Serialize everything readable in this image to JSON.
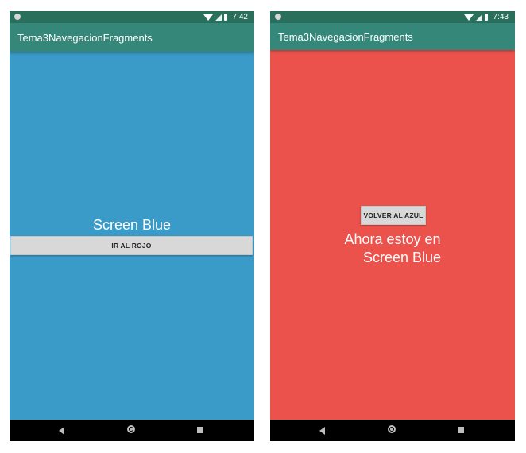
{
  "colors": {
    "left_status": "#2a6f5c",
    "left_appbar": "#348779",
    "left_content": "#3a9ac8",
    "right_status": "#2a6f5c",
    "right_appbar": "#348779",
    "right_content": "#ec524c"
  },
  "left": {
    "status_time": "7:42",
    "app_title": "Tema3NavegacionFragments",
    "screen_title": "Screen Blue",
    "button_label": "IR AL ROJO"
  },
  "right": {
    "status_time": "7:43",
    "app_title": "Tema3NavegacionFragments",
    "button_label": "VOLVER AL AZUL",
    "message_line1": "Ahora estoy en",
    "message_line2": "Screen Blue"
  },
  "icons": {
    "status": [
      "notification-dot-icon",
      "wifi-icon",
      "signal-icon",
      "battery-icon"
    ],
    "nav": [
      "back-icon",
      "home-icon",
      "recents-icon"
    ]
  }
}
